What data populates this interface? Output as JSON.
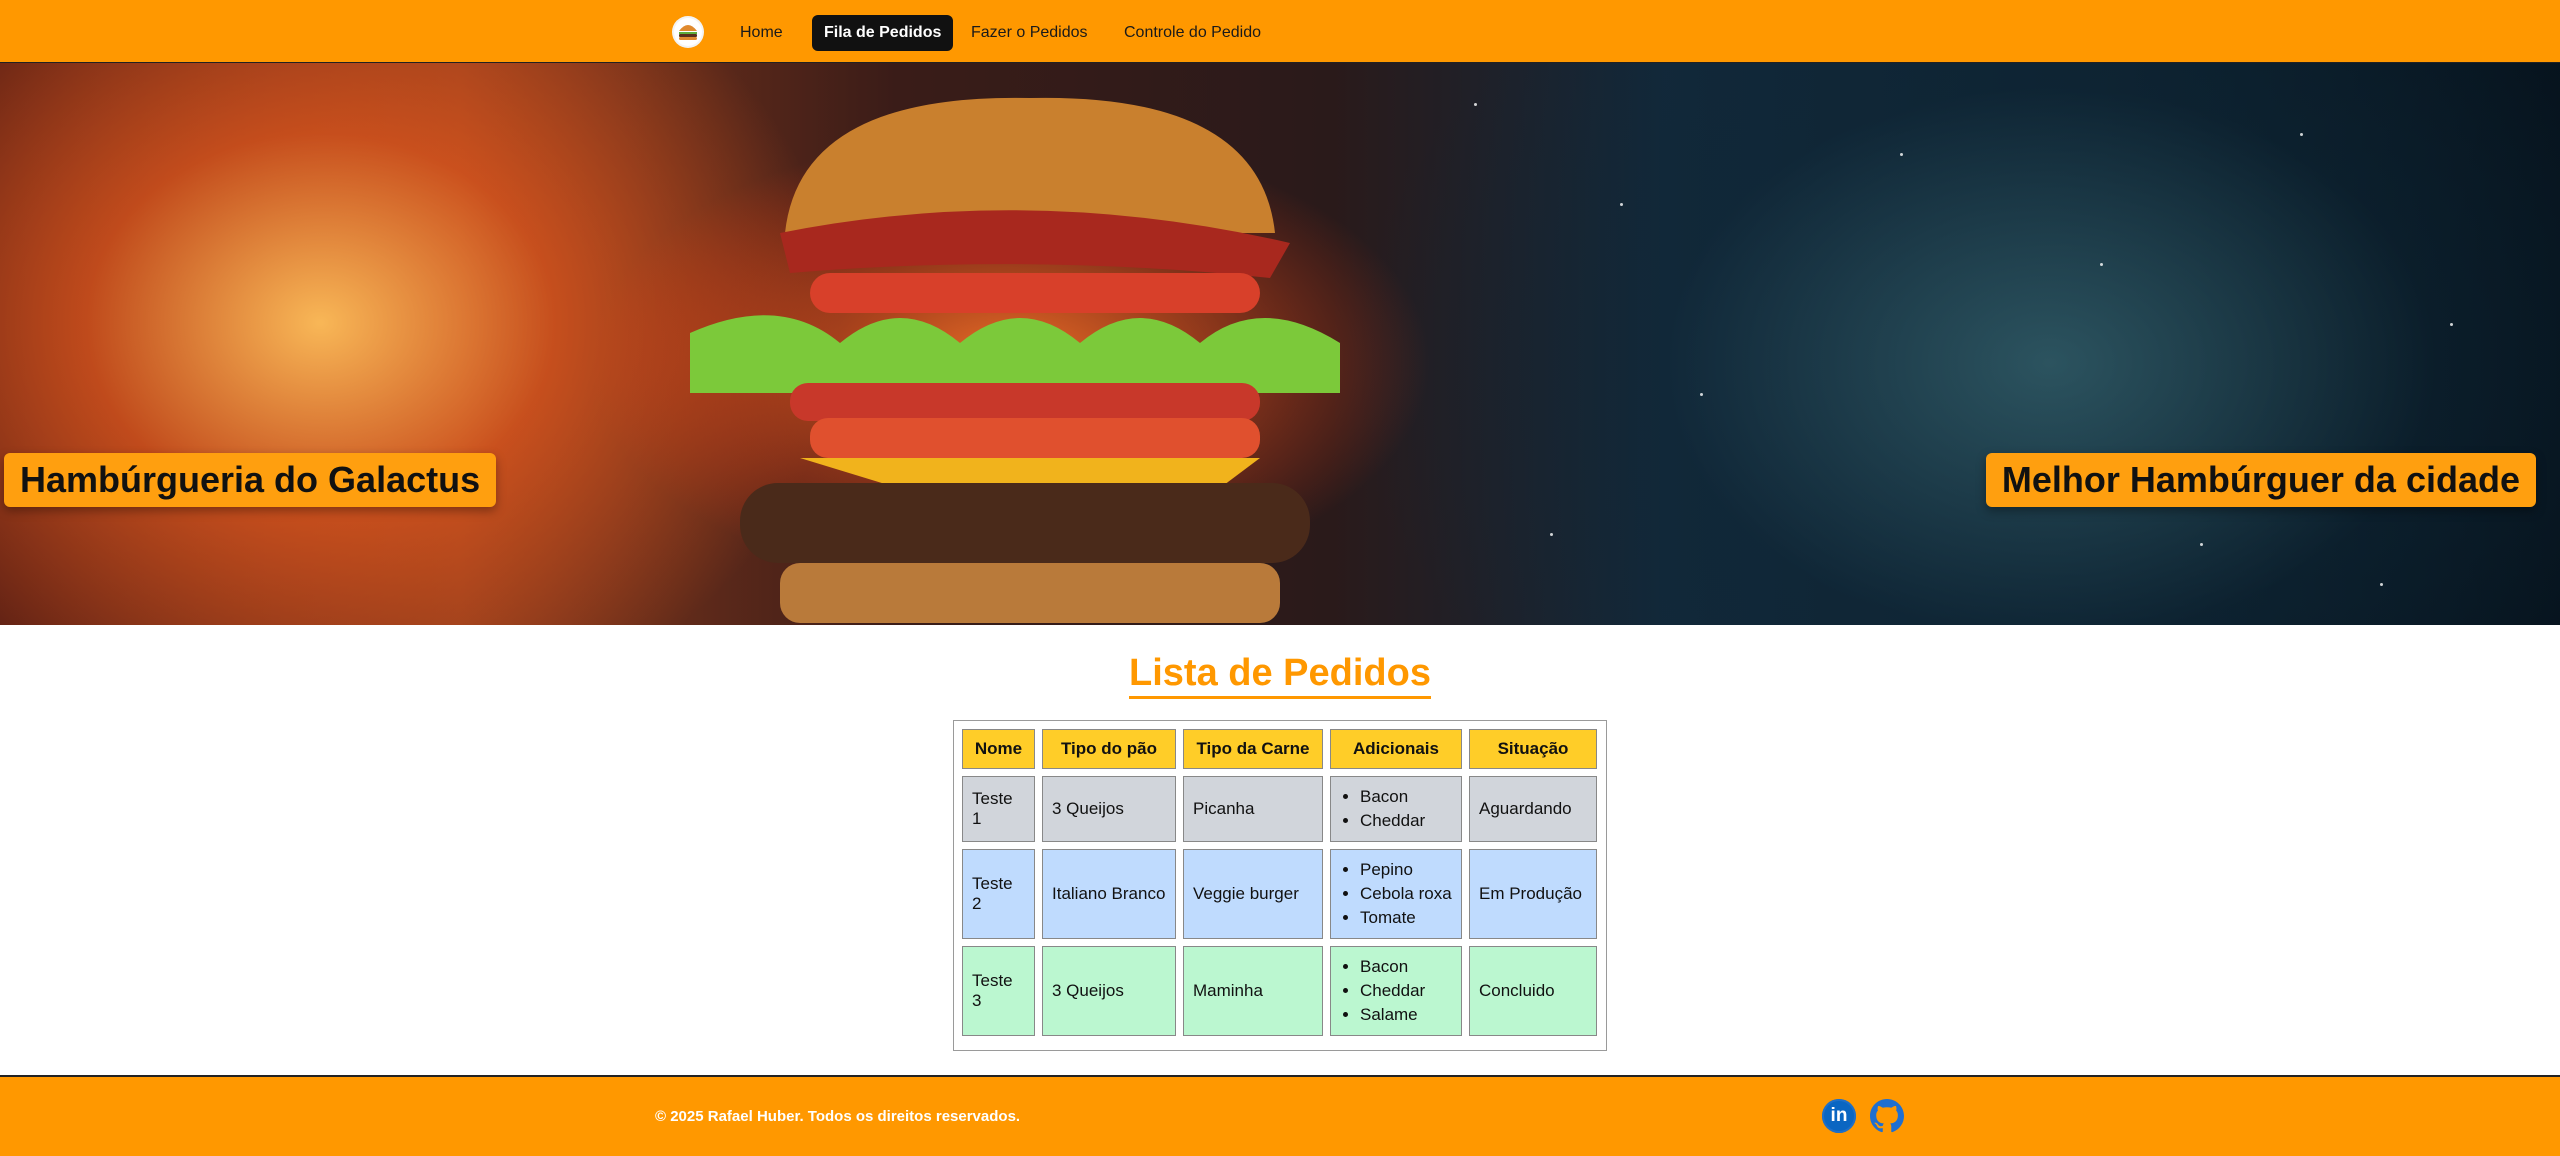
{
  "nav": {
    "logo_icon": "burger-icon",
    "links": [
      {
        "label": "Home",
        "active": false
      },
      {
        "label": "Fila de Pedidos",
        "active": true
      },
      {
        "label": "Fazer o Pedidos",
        "active": false
      },
      {
        "label": "Controle do Pedido",
        "active": false
      }
    ]
  },
  "hero": {
    "left_badge": "Hambúrgueria do Galactus",
    "right_badge": "Melhor Hambúrguer da cidade"
  },
  "orders": {
    "title": "Lista de Pedidos",
    "headers": [
      "Nome",
      "Tipo do pão",
      "Tipo da Carne",
      "Adicionais",
      "Situação"
    ],
    "rows": [
      {
        "nome": "Teste 1",
        "pao": "3 Queijos",
        "carne": "Picanha",
        "adicionais": [
          "Bacon",
          "Cheddar"
        ],
        "situacao": "Aguardando"
      },
      {
        "nome": "Teste 2",
        "pao": "Italiano Branco",
        "carne": "Veggie burger",
        "adicionais": [
          "Pepino",
          "Cebola roxa",
          "Tomate"
        ],
        "situacao": "Em Produção"
      },
      {
        "nome": "Teste 3",
        "pao": "3 Queijos",
        "carne": "Maminha",
        "adicionais": [
          "Bacon",
          "Cheddar",
          "Salame"
        ],
        "situacao": "Concluido"
      }
    ],
    "row_colors": [
      "#d1d5db",
      "#bfdbfe",
      "#bbf7d0"
    ]
  },
  "footer": {
    "copyright": "© 2025 Rafael Huber. Todos os direitos reservados.",
    "social": [
      {
        "icon": "linkedin-icon"
      },
      {
        "icon": "github-icon"
      }
    ]
  },
  "colors": {
    "brand": "#ff9800",
    "header_cell": "#ffcd28"
  }
}
